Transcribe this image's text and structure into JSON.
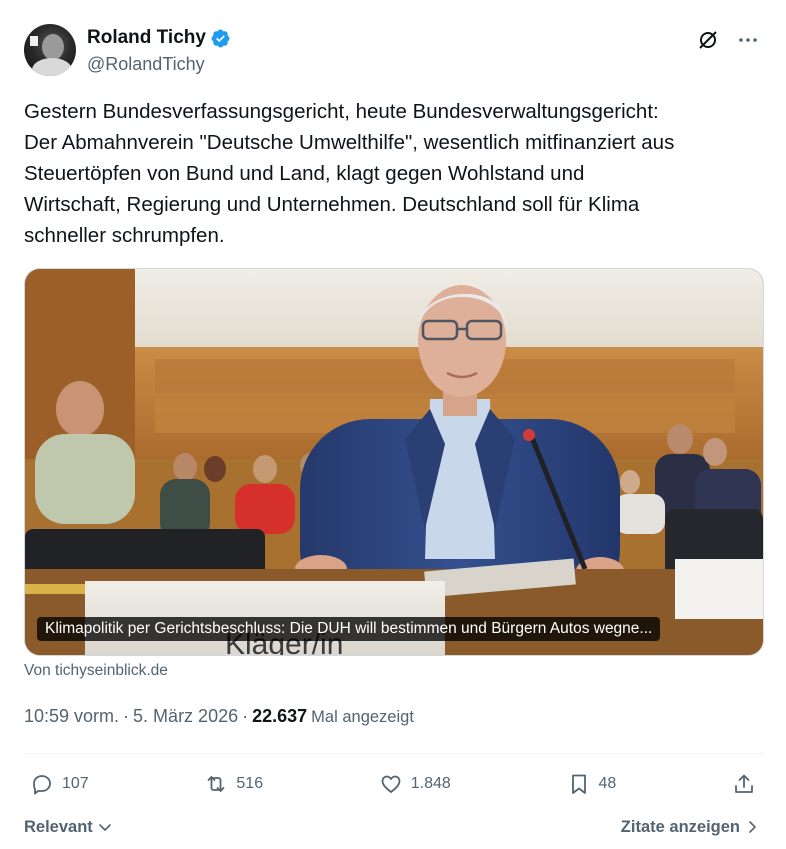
{
  "author": {
    "name": "Roland Tichy",
    "handle": "@RolandTichy"
  },
  "tweet": {
    "text": "Gestern Bundesverfassungsgericht, heute Bundesverwaltungsgericht:\nDer Abmahnverein \"Deutsche Umwelthilfe\", wesentlich mitfinanziert aus\nSteuertöpfen von Bund und Land, klagt gegen Wohlstand und\nWirtschaft, Regierung und Unternehmen. Deutschland soll für Klima\nschneller schrumpfen."
  },
  "card": {
    "caption": "Klimapolitik per Gerichtsbeschluss: Die DUH will bestimmen und Bürgern Autos wegne...",
    "nameplate": "Kläger/in",
    "source": "Von tichyseinblick.de"
  },
  "meta": {
    "time": "10:59 vorm.",
    "sep1": "·",
    "date": "5. März 2026",
    "sep2": "·",
    "views": "22.637",
    "views_label": "Mal angezeigt"
  },
  "actions": {
    "replies": "107",
    "reposts": "516",
    "likes": "1.848",
    "bookmarks": "48"
  },
  "footer": {
    "sort": "Relevant",
    "quotes": "Zitate anzeigen"
  },
  "icons": {
    "verified": "verified-badge-icon",
    "grok": "grok-icon",
    "more": "more-icon",
    "reply": "reply-icon",
    "repost": "repost-icon",
    "like": "like-icon",
    "bookmark": "bookmark-icon",
    "share": "share-icon"
  },
  "colors": {
    "verified": "#1d9bf0",
    "text": "#0f1419",
    "secondary": "#536471"
  }
}
